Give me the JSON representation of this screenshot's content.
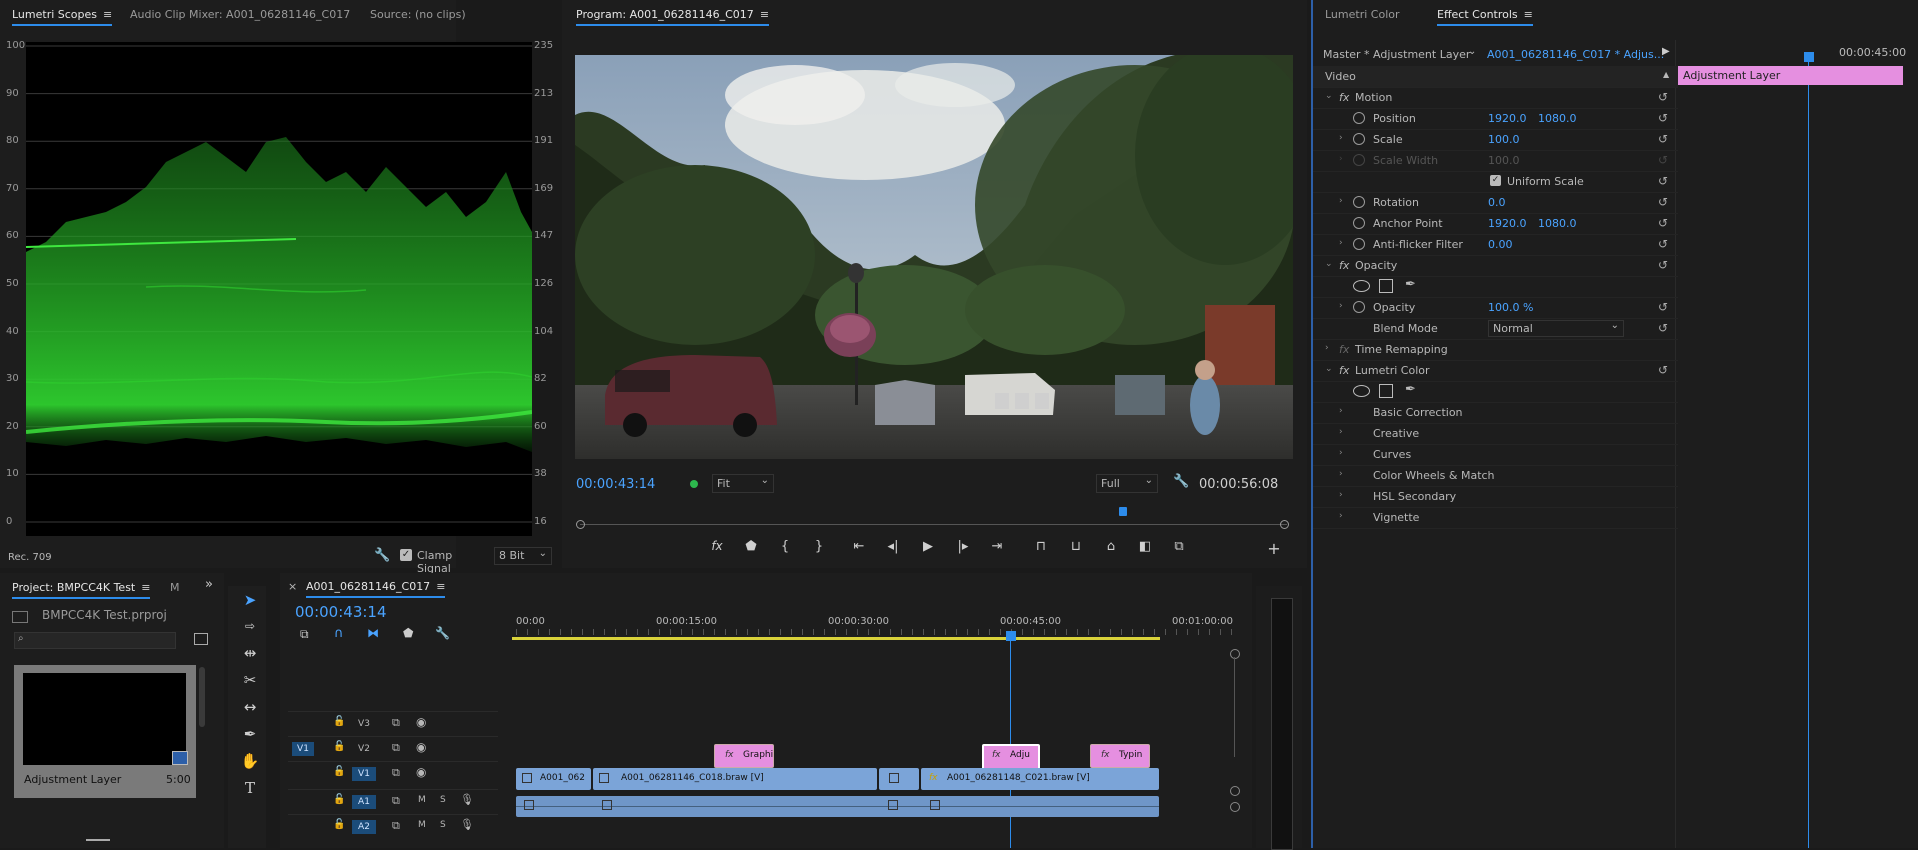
{
  "scopes": {
    "tabs": [
      "Lumetri Scopes",
      "Audio Clip Mixer: A001_06281146_C017",
      "Source: (no clips)"
    ],
    "left_scale": [
      "100",
      "90",
      "80",
      "70",
      "60",
      "50",
      "40",
      "30",
      "20",
      "10",
      "0"
    ],
    "right_scale": [
      "235",
      "213",
      "191",
      "169",
      "147",
      "126",
      "104",
      "82",
      "60",
      "38",
      "16"
    ],
    "colorspace": "Rec. 709",
    "clamp_label": "Clamp Signal",
    "bit_depth": "8 Bit",
    "colors": {
      "waveform": "#2fd02f"
    }
  },
  "program": {
    "title": "Program: A001_06281146_C017",
    "timecode": "00:00:43:14",
    "fit": "Fit",
    "quality": "Full",
    "duration": "00:00:56:08"
  },
  "effects": {
    "tabs": [
      "Lumetri Color",
      "Effect Controls"
    ],
    "master_label": "Master * Adjustment Layer",
    "clip_label": "A001_06281146_C017 * Adjus...",
    "timeline_time": "00:00:45:00",
    "timeline_clip": "Adjustment Layer",
    "section": "Video",
    "rows": {
      "motion": "Motion",
      "position": "Position",
      "position_x": "1920.0",
      "position_y": "1080.0",
      "scale": "Scale",
      "scale_v": "100.0",
      "scale_width": "Scale Width",
      "scale_width_v": "100.0",
      "uniform": "Uniform Scale",
      "rotation": "Rotation",
      "rotation_v": "0.0",
      "anchor": "Anchor Point",
      "anchor_x": "1920.0",
      "anchor_y": "1080.0",
      "antiflicker": "Anti-flicker Filter",
      "antiflicker_v": "0.00",
      "opacity_group": "Opacity",
      "opacity": "Opacity",
      "opacity_v": "100.0 %",
      "blend": "Blend Mode",
      "blend_v": "Normal",
      "time_remap": "Time Remapping",
      "lumetri": "Lumetri Color",
      "basic": "Basic Correction",
      "creative": "Creative",
      "curves": "Curves",
      "wheels": "Color Wheels & Match",
      "hsl": "HSL Secondary",
      "vignette": "Vignette"
    },
    "fx_badge": "fx"
  },
  "project": {
    "tab": "Project: BMPCC4K Test",
    "tab2": "M",
    "file": "BMPCC4K Test.prproj",
    "item_name": "Adjustment Layer",
    "item_dur": "5:00"
  },
  "timeline": {
    "seq": "A001_06281146_C017",
    "timecode": "00:00:43:14",
    "ruler": [
      "00:00",
      "00:00:15:00",
      "00:00:30:00",
      "00:00:45:00",
      "00:01:00:00"
    ],
    "tracks": {
      "v3": "V3",
      "v2": "V2",
      "v1": "V1",
      "a1": "A1",
      "a2": "A2",
      "v1_src": "V1",
      "m": "M",
      "s": "S"
    },
    "clips": {
      "graphic": "Graphi",
      "adju": "Adju",
      "typin": "Typin",
      "c1": "A001_062",
      "c2": "A001_06281146_C018.braw [V]",
      "c4": "A001_06281148_C021.braw [V]"
    }
  }
}
